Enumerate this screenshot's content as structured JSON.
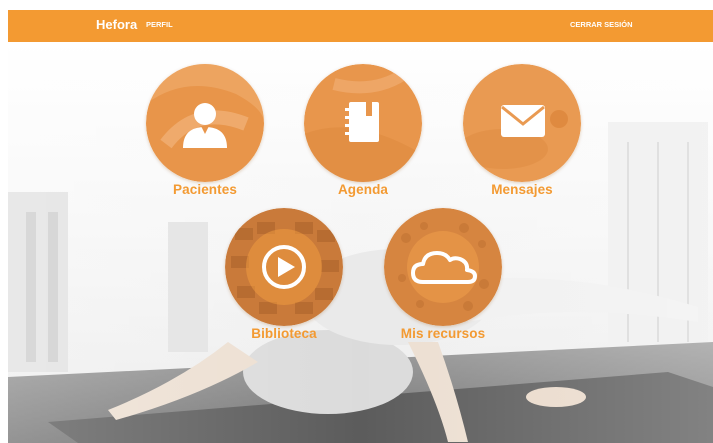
{
  "header": {
    "brand": "Hefora",
    "nav_perfil": "PERFIL",
    "logout": "CERRAR SESIÓN"
  },
  "tiles": [
    {
      "label": "Pacientes",
      "icon": "patient-icon"
    },
    {
      "label": "Agenda",
      "icon": "agenda-icon"
    },
    {
      "label": "Mensajes",
      "icon": "mail-icon"
    },
    {
      "label": "Biblioteca",
      "icon": "play-icon"
    },
    {
      "label": "Mis recursos",
      "icon": "cloud-icon"
    }
  ],
  "colors": {
    "accent": "#f39a32",
    "label_text": "#f39a32",
    "circle_fill": "#e8954a",
    "header_text": "#ffffff"
  }
}
